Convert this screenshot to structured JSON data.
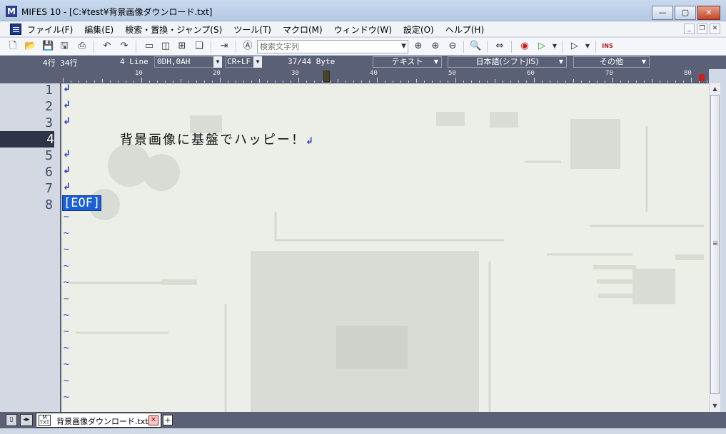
{
  "window": {
    "title": "MIFES 10 - [C:¥test¥背景画像ダウンロード.txt]",
    "app_icon": "mifes-app-icon"
  },
  "menu": {
    "items": [
      "ファイル(F)",
      "編集(E)",
      "検索・置換・ジャンプ(S)",
      "ツール(T)",
      "マクロ(M)",
      "ウィンドウ(W)",
      "設定(O)",
      "ヘルプ(H)"
    ]
  },
  "toolbar": {
    "search_placeholder": "検索文字列"
  },
  "status": {
    "line_col": "4行  34行",
    "line_mode": "4 Line",
    "eol_code": "0DH,0AH",
    "eol_type": "CR+LF",
    "position": "37/44 Byte",
    "mode": "テキスト",
    "encoding": "日本語(シフトJIS)",
    "other": "その他"
  },
  "ruler": {
    "marks": [
      "10",
      "20",
      "30",
      "40",
      "50",
      "60",
      "70",
      "80"
    ]
  },
  "editor": {
    "line_numbers": [
      "1",
      "2",
      "3",
      "4",
      "5",
      "6",
      "7",
      "8"
    ],
    "current_line": "4",
    "line4_text": "背景画像に基盤でハッピー！",
    "eof_marker": "[EOF]",
    "crlf_glyph": "↲",
    "tilde": "~"
  },
  "tabs": {
    "active_tab_label": "背景画像ダウンロード.txt",
    "tab_icon_text": "TXT"
  },
  "colors": {
    "status_bg": "#5a6177",
    "eof_bg": "#1a5fd3",
    "crlf_color": "#2a3ec2",
    "current_line_bg": "#2d3447"
  }
}
